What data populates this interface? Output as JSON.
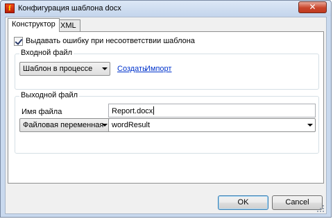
{
  "window": {
    "title": "Конфигурация шаблона docx",
    "close_glyph": "✕"
  },
  "tabs": [
    {
      "label": "Конструктор",
      "active": true
    },
    {
      "label": "XML",
      "active": false
    }
  ],
  "options": {
    "error_on_mismatch_label": "Выдавать ошибку при несоответствии шаблона",
    "error_on_mismatch_checked": true
  },
  "input_group": {
    "legend": "Входной файл",
    "source_select": "Шаблон в процессе",
    "create_link": "Создать",
    "import_link": "Импорт"
  },
  "output_group": {
    "legend": "Выходной файл",
    "filename_label": "Имя файла",
    "filename_value": "Report.docx",
    "variable_type_select": "Файловая переменная",
    "result_variable_select": "wordResult"
  },
  "buttons": {
    "ok": "OK",
    "cancel": "Cancel"
  },
  "icons": {
    "app": "app-logo-icon",
    "close": "close-icon",
    "dropdown": "chevron-down-icon",
    "check": "checkmark-icon",
    "resize": "resize-grip-icon"
  },
  "colors": {
    "link": "#0033cc",
    "close_button": "#c9462c",
    "title_bar": "#c4d5ec"
  }
}
